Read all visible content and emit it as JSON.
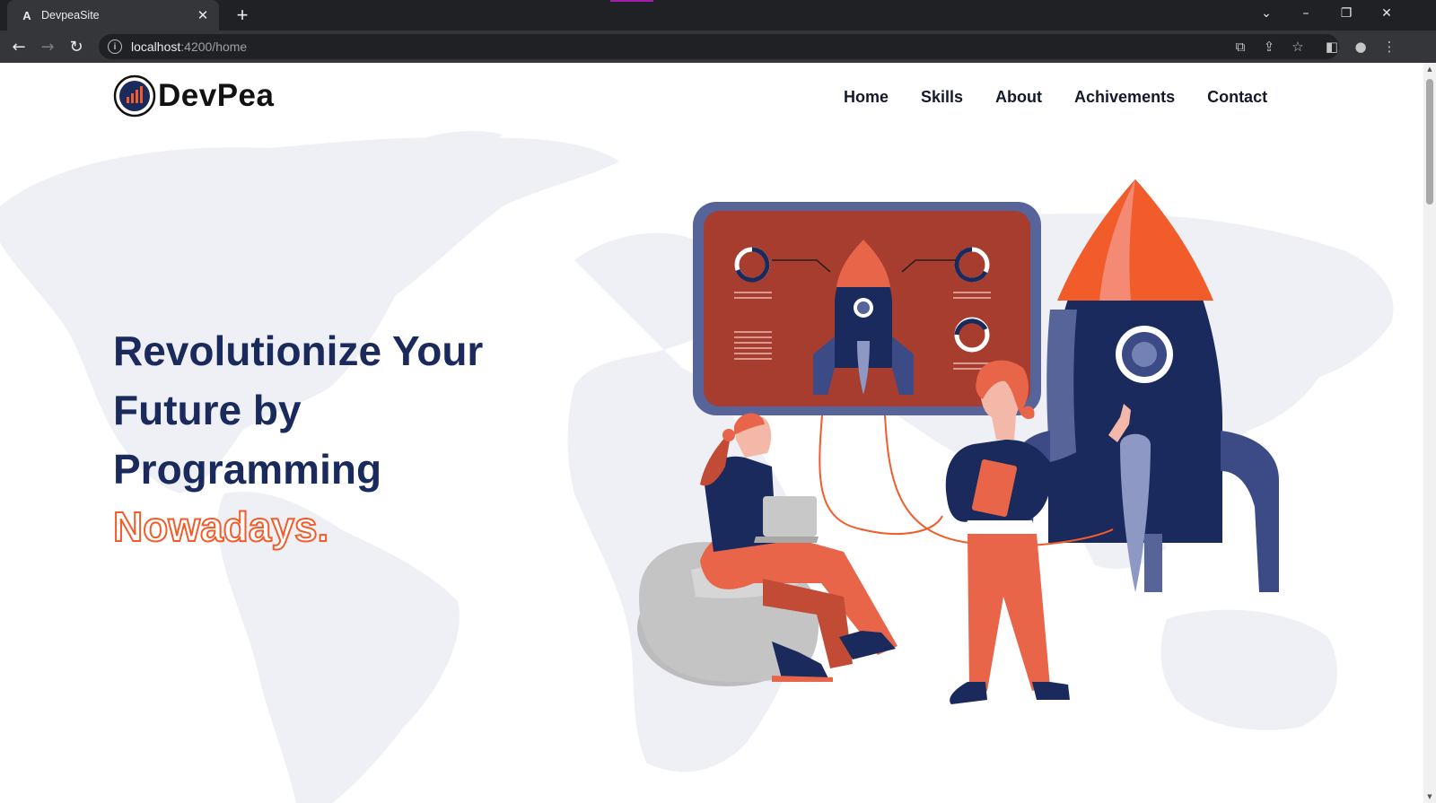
{
  "browser": {
    "tab_title": "DevpeaSite",
    "favicon_letter": "A",
    "url_host": "localhost",
    "url_rest": ":4200/home"
  },
  "site": {
    "logo_text": "DevPea",
    "nav": [
      "Home",
      "Skills",
      "About",
      "Achivements",
      "Contact"
    ]
  },
  "hero": {
    "line1": "Revolutionize Your",
    "line2": "Future by",
    "line3": "Programming",
    "highlight": "Nowadays."
  },
  "colors": {
    "brand_navy": "#1b2a5c",
    "accent_orange": "#f25c2a",
    "panel_red": "#a63d2e",
    "map_gray": "#eef0f5"
  }
}
